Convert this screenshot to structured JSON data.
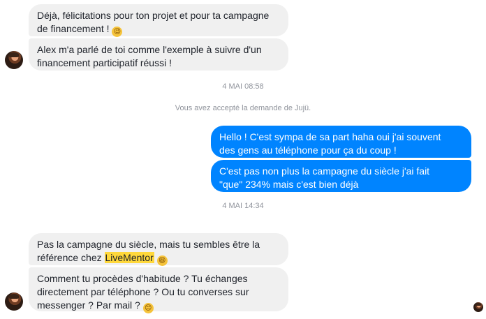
{
  "messages": [
    {
      "text": "Déjà, félicitations pour ton projet et pour ta campagne\nde financement !",
      "emoji": "😉"
    },
    {
      "text": "Alex m'a parlé de toi comme l'exemple à suivre d'un\nfinancement participatif réussi !"
    },
    {
      "text": "Hello ! C'est sympa de sa part haha oui j'ai souvent\ndes gens au téléphone pour ça du coup !"
    },
    {
      "text": "C'est pas non plus la campagne du siècle j'ai fait\n\"que\" 234% mais c'est bien déjà"
    },
    {
      "text_before": "Pas la campagne du siècle, mais tu sembles être la\nréférence chez ",
      "highlight": "LiveMentor",
      "emoji": "😆"
    },
    {
      "text": "Comment tu procèdes d'habitude ? Tu échanges\ndirectement par téléphone ? Ou tu converses sur\nmessenger ? Par mail ?",
      "emoji": "😊"
    }
  ],
  "timestamps": [
    "4 MAI 08:58",
    "4 MAI 14:34"
  ],
  "system_message": "Vous avez accepté la demande de Jujü.",
  "colors": {
    "outgoing_bubble": "#0084ff",
    "incoming_bubble": "#f0f0f0",
    "highlight": "#ffd83b",
    "meta_text": "#90949c"
  },
  "icons": {
    "wink": "winking-face-emoji",
    "laugh": "grinning-squinting-face-emoji",
    "smile": "smiling-face-emoji"
  }
}
